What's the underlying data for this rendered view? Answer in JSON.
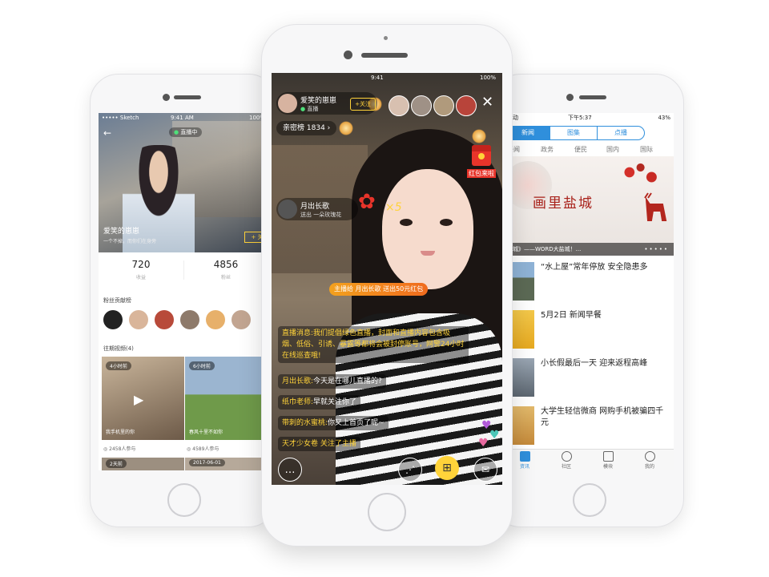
{
  "left_phone": {
    "status": {
      "carrier": "••••• Sketch",
      "time": "9:41 AM",
      "battery": "100%"
    },
    "live_badge": "直播中",
    "anchor_name": "爱笑的崽崽",
    "anchor_slogan": "一个不掉，而你们在身旁",
    "follow_label": "+ 关",
    "stats": [
      {
        "value": "720",
        "label": "收益"
      },
      {
        "value": "4856",
        "label": "粉丝"
      }
    ],
    "fans_title": "粉丝贡献榜",
    "past_videos_title": "往期视频(4)",
    "videos": [
      {
        "tag": "4小时前",
        "caption": "我手机里的你",
        "meta": "2458人参与"
      },
      {
        "tag": "6小时前",
        "caption": "春风十里不如你",
        "meta": "4589人参与"
      }
    ],
    "more_tags": [
      "2天前",
      "2017-06-01"
    ]
  },
  "center_phone": {
    "status": {
      "time": "9:41",
      "battery": "100%"
    },
    "anchor_name": "爱笑的崽崽",
    "anchor_sub": "直播",
    "follow_label": "关注",
    "intimacy_label": "亲密榜",
    "intimacy_value": "1834",
    "gift_sender": "月出长歌",
    "gift_text": "送出 一朵玫瑰花",
    "gift_count": "×5",
    "red_packet_label": "红包来啦",
    "banner": "主播给 月出长歌 送出50元红包",
    "chat": [
      {
        "user": "直播消息:",
        "text": "我们提倡绿色直播，封面和直播内容包含吸烟、低俗、引诱、暴露等都将会被封停账号，网警24小时在线巡查哦!"
      },
      {
        "user": "月出长歌:",
        "text": "今天是在哪儿直播的?"
      },
      {
        "user": "纸巾老师:",
        "text": "早就关注你了"
      },
      {
        "user": "带刺的水蜜桃:",
        "text": "你又上首页了呢~"
      },
      {
        "user": "天才少女卷",
        "text": "关注了主播"
      }
    ]
  },
  "right_phone": {
    "status": {
      "carrier": "移动",
      "time": "下午5:37",
      "battery": "43%"
    },
    "segments": [
      "新闻",
      "图集",
      "点播"
    ],
    "categories": [
      "要闻",
      "政务",
      "便民",
      "国内",
      "国际"
    ],
    "banner_title": "画里盐城",
    "banner_caption": "盐城》——WORD大盐城！...",
    "news": [
      {
        "title": "“水上屋”常年停放 安全隐患多"
      },
      {
        "title": "5月2日 新闻早餐"
      },
      {
        "title": "小长假最后一天 迎来返程高峰"
      },
      {
        "title": "大学生轻信微商 网购手机被骗四千元"
      }
    ],
    "bottom_nav": [
      "资讯",
      "社区",
      "模块",
      "我的"
    ]
  },
  "colors": {
    "accent_blue": "#2f8fdc",
    "chat_yellow": "#ffd33a",
    "banner_orange": "#f08a24",
    "gift_red": "#e8342a"
  }
}
